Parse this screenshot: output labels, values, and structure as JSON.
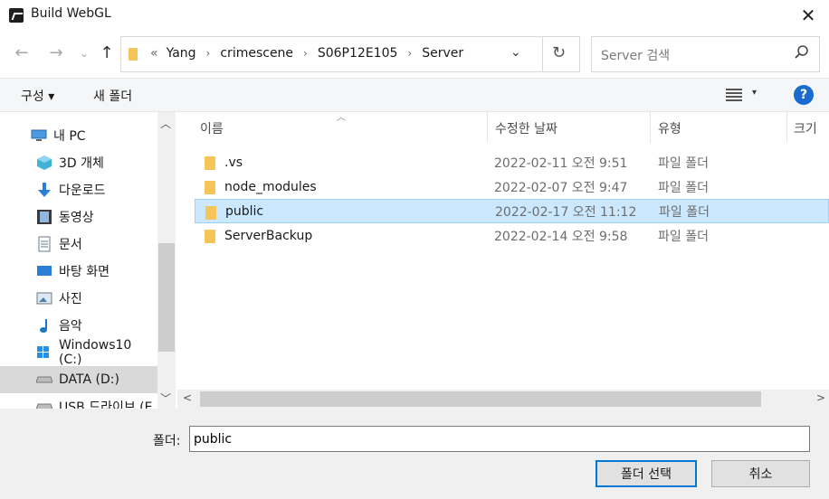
{
  "window": {
    "title": "Build WebGL",
    "close_glyph": "✕"
  },
  "nav": {
    "back_glyph": "←",
    "forward_glyph": "→",
    "recent_glyph": "⌄",
    "up_glyph": "↑"
  },
  "address": {
    "overflow": "«",
    "crumbs": [
      "Yang",
      "crimescene",
      "S06P12E105",
      "Server"
    ],
    "separator": "›",
    "dropdown_glyph": "⌄",
    "refresh_glyph": "↻"
  },
  "search": {
    "placeholder": "Server 검색",
    "icon": "search-icon"
  },
  "toolbar": {
    "organize_label": "구성 ▾",
    "new_folder_label": "새 폴더",
    "view_dropdown": "▾",
    "help_label": "?"
  },
  "nav_pane": {
    "items": [
      {
        "label": "내 PC",
        "icon": "this-pc-icon"
      },
      {
        "label": "3D 개체",
        "icon": "3d-objects-icon"
      },
      {
        "label": "다운로드",
        "icon": "downloads-icon"
      },
      {
        "label": "동영상",
        "icon": "videos-icon"
      },
      {
        "label": "문서",
        "icon": "documents-icon"
      },
      {
        "label": "바탕 화면",
        "icon": "desktop-icon"
      },
      {
        "label": "사진",
        "icon": "pictures-icon"
      },
      {
        "label": "음악",
        "icon": "music-icon"
      },
      {
        "label": "Windows10 (C:)",
        "icon": "drive-c-icon"
      },
      {
        "label": "DATA (D:)",
        "icon": "drive-d-icon"
      },
      {
        "label": "USB 드라이브 (E",
        "icon": "usb-drive-icon"
      }
    ],
    "selected_index": 9
  },
  "columns": {
    "name": "이름",
    "date": "수정한 날짜",
    "type": "유형",
    "size": "크기"
  },
  "files": [
    {
      "name": ".vs",
      "date": "2022-02-11 오전 9:51",
      "type": "파일 폴더"
    },
    {
      "name": "node_modules",
      "date": "2022-02-07 오전 9:47",
      "type": "파일 폴더"
    },
    {
      "name": "public",
      "date": "2022-02-17 오전 11:12",
      "type": "파일 폴더"
    },
    {
      "name": "ServerBackup",
      "date": "2022-02-14 오전 9:58",
      "type": "파일 폴더"
    }
  ],
  "selected_file_index": 2,
  "footer": {
    "folder_label": "폴더:",
    "folder_value": "public",
    "select_button": "폴더 선택",
    "cancel_button": "취소"
  }
}
